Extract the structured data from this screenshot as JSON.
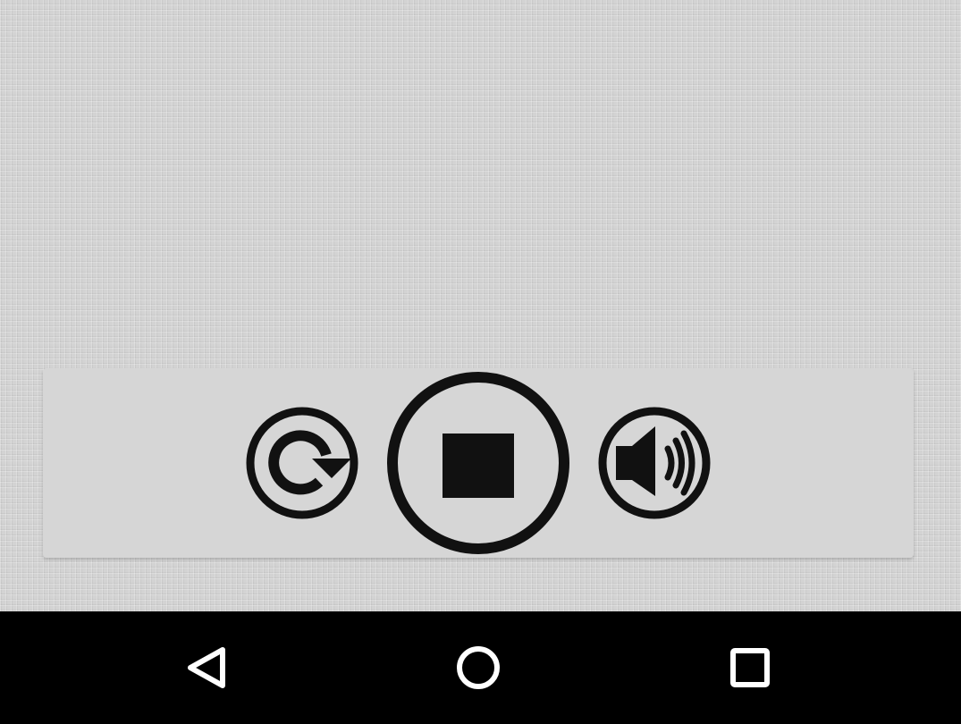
{
  "colors": {
    "panel_background": "#d6d6d6",
    "control_stroke": "#111111",
    "nav_bar_background": "#000000",
    "nav_icon": "#ffffff"
  },
  "player": {
    "controls": [
      {
        "icon": "replay-icon"
      },
      {
        "icon": "stop-icon"
      },
      {
        "icon": "volume-icon"
      }
    ]
  },
  "nav_bar": {
    "buttons": [
      {
        "icon": "back-triangle-icon"
      },
      {
        "icon": "home-circle-icon"
      },
      {
        "icon": "recents-square-icon"
      }
    ]
  }
}
